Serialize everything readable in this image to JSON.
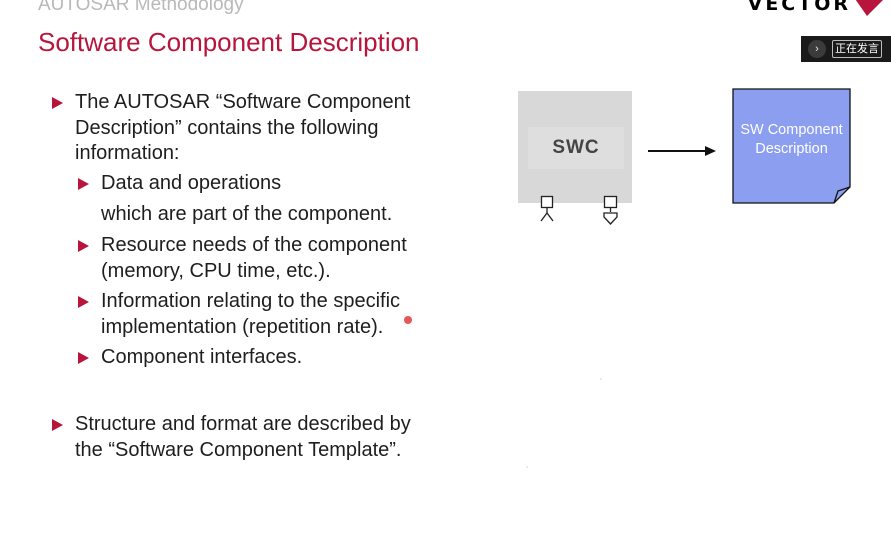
{
  "slide": {
    "supertitle": "AUTOSAR Methodology",
    "title": "Software Component Description"
  },
  "logo": {
    "text": "VECTOR",
    "accent_color": "#b8153d"
  },
  "overlay": {
    "speaking_label": "正在发言",
    "expand_icon": "chevron-right-icon"
  },
  "bullets": {
    "b1": {
      "lines": [
        "The AUTOSAR “Software Component",
        "Description” contains the following",
        "information:"
      ]
    },
    "s1": {
      "lines": [
        "Data and operations",
        "which are part of the component."
      ]
    },
    "s2": {
      "lines": [
        "Resource needs of the component",
        "(memory, CPU time, etc.)."
      ]
    },
    "s3": {
      "lines": [
        "Information relating to the specific",
        "implementation (repetition rate)."
      ]
    },
    "s4": {
      "lines": [
        "Component interfaces."
      ]
    },
    "b2": {
      "lines": [
        "Structure and format are described by",
        "the “Software Component Template”."
      ]
    }
  },
  "diagram": {
    "swc_label": "SWC",
    "description_label_lines": [
      "SW Component",
      "Description"
    ],
    "description_fill": "#8b9ef0",
    "port_icons": [
      "receiver-port-icon",
      "sender-port-icon"
    ],
    "arrow": "arrow-right-icon"
  }
}
